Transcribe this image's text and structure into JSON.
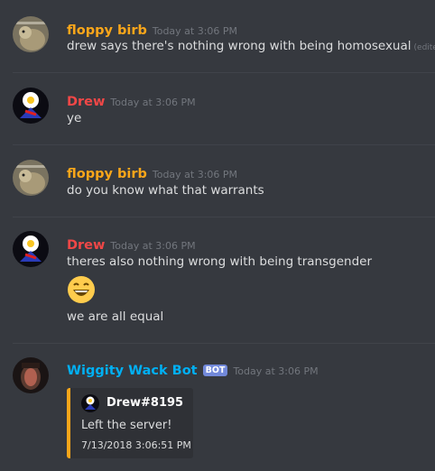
{
  "messages": [
    {
      "author": "floppy birb",
      "author_color": "#faa61a",
      "timestamp": "Today at 3:06 PM",
      "text": "drew says there's nothing wrong with being homosexual",
      "edited": "(edited)"
    },
    {
      "author": "Drew",
      "author_color": "#f04747",
      "timestamp": "Today at 3:06 PM",
      "text": "ye"
    },
    {
      "author": "floppy birb",
      "author_color": "#faa61a",
      "timestamp": "Today at 3:06 PM",
      "text": "do you know what that warrants"
    },
    {
      "author": "Drew",
      "author_color": "#f04747",
      "timestamp": "Today at 3:06 PM",
      "text": "theres also nothing wrong with being transgender",
      "emoji": "grinning-face-emoji",
      "text2": "we are all equal"
    },
    {
      "author": "Wiggity Wack Bot",
      "author_color": "#00b0f4",
      "badge": "BOT",
      "timestamp": "Today at 3:06 PM",
      "embed": {
        "author": "Drew#8195",
        "description": "Left the server!",
        "footer": "7/13/2018 3:06:51 PM",
        "accent_color": "#faa61a"
      }
    }
  ]
}
